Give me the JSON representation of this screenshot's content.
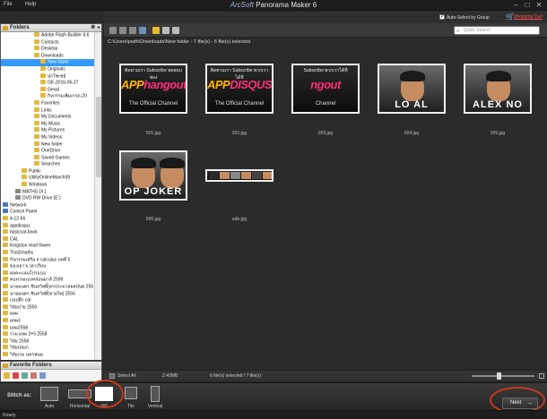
{
  "menu": {
    "file": "File",
    "help": "Help"
  },
  "app": {
    "brand": "ArcSoft",
    "title": " Panorama Maker 6"
  },
  "window_buttons": {
    "minimize": "–",
    "maximize": "□",
    "close": "✕"
  },
  "top_bar": {
    "auto_select_label": "Auto-Select by Group",
    "auto_select_checked": true,
    "shopping_cart": "Shopping Cart"
  },
  "search": {
    "placeholder": "Quick Search"
  },
  "path": {
    "text": "C:\\Users\\pwth\\Downloads\\New folder - 7 file(s)   - 6 file(s) selected"
  },
  "folders_panel": {
    "title": "Folders",
    "items": [
      {
        "label": "Adobe Flash Builder 4.6",
        "indent": 5,
        "icon": "folder"
      },
      {
        "label": "Contacts",
        "indent": 5,
        "icon": "folder"
      },
      {
        "label": "Desktop",
        "indent": 5,
        "icon": "folder"
      },
      {
        "label": "Downloads",
        "indent": 5,
        "icon": "folder"
      },
      {
        "label": "New folder",
        "indent": 6,
        "icon": "folder",
        "selected": true
      },
      {
        "label": "Originals",
        "indent": 6,
        "icon": "folder"
      },
      {
        "label": "ปกโซเชย์",
        "indent": 6,
        "icon": "folder"
      },
      {
        "label": "GE-2016-06-27",
        "indent": 6,
        "icon": "folder"
      },
      {
        "label": "Gmail",
        "indent": 6,
        "icon": "folder"
      },
      {
        "label": "กิจกรรมเพิ่มเกรด-20",
        "indent": 6,
        "icon": "folder"
      },
      {
        "label": "Favorites",
        "indent": 5,
        "icon": "folder"
      },
      {
        "label": "Links",
        "indent": 5,
        "icon": "folder"
      },
      {
        "label": "My Documents",
        "indent": 5,
        "icon": "folder"
      },
      {
        "label": "My Music",
        "indent": 5,
        "icon": "folder"
      },
      {
        "label": "My Pictures",
        "indent": 5,
        "icon": "folder"
      },
      {
        "label": "My Videos",
        "indent": 5,
        "icon": "folder"
      },
      {
        "label": "New folder",
        "indent": 5,
        "icon": "folder"
      },
      {
        "label": "OneDrive",
        "indent": 5,
        "icon": "folder"
      },
      {
        "label": "Saved Games",
        "indent": 5,
        "icon": "folder"
      },
      {
        "label": "Searches",
        "indent": 5,
        "icon": "folder"
      },
      {
        "label": "Public",
        "indent": 3,
        "icon": "folder"
      },
      {
        "label": "UtilityOnlineMarch09",
        "indent": 3,
        "icon": "folder"
      },
      {
        "label": "Windows",
        "indent": 3,
        "icon": "folder"
      },
      {
        "label": "MATHS (X:)",
        "indent": 2,
        "icon": "drive"
      },
      {
        "label": "DVD RW Drive (E:)",
        "indent": 2,
        "icon": "drive"
      },
      {
        "label": "Network",
        "indent": 0,
        "icon": "blue"
      },
      {
        "label": "Control Panel",
        "indent": 0,
        "icon": "blue"
      },
      {
        "label": "4-12-56",
        "indent": 0,
        "icon": "folder"
      },
      {
        "label": "appdisqus",
        "indent": 0,
        "icon": "folder"
      },
      {
        "label": "basiccal-book",
        "indent": 0,
        "icon": "folder"
      },
      {
        "label": "CAL",
        "indent": 0,
        "icon": "folder"
      },
      {
        "label": "Kingston read flower",
        "indent": 0,
        "icon": "folder"
      },
      {
        "label": "Thai2maths",
        "indent": 0,
        "icon": "folder"
      },
      {
        "label": "กิจกรรมเสริม e calculus บทที่ 5",
        "indent": 0,
        "icon": "folder"
      },
      {
        "label": "ของเยาวเวลาเรียน",
        "indent": 0,
        "icon": "folder"
      },
      {
        "label": "ผลคะแนนโปรแบบ",
        "indent": 0,
        "icon": "folder"
      },
      {
        "label": "ทบทวนแบงหล่อนมาล์ 2599",
        "indent": 0,
        "icon": "folder"
      },
      {
        "label": "นายมนตร ชินสวัสดิ์(ครประมวลผลบันต 256",
        "indent": 0,
        "icon": "folder"
      },
      {
        "label": "นายมนตร ชินสวัสดิ์(ทายไท) 2556",
        "indent": 0,
        "icon": "folder"
      },
      {
        "label": "แบบฝึก cal",
        "indent": 0,
        "icon": "folder"
      },
      {
        "label": "วิจัยปาย 2559",
        "indent": 0,
        "icon": "folder"
      },
      {
        "label": "ผลผ",
        "indent": 0,
        "icon": "folder"
      },
      {
        "label": "ผลผ3",
        "indent": 0,
        "icon": "folder"
      },
      {
        "label": "ผลผ2558",
        "indent": 0,
        "icon": "folder"
      },
      {
        "label": "รวม ผลผ 2+5 2558",
        "indent": 0,
        "icon": "folder"
      },
      {
        "label": "วิจัย 2558",
        "indent": 0,
        "icon": "folder"
      },
      {
        "label": "วิจัยปลอก",
        "indent": 0,
        "icon": "folder"
      },
      {
        "label": "วิจัยเรม นครพนม",
        "indent": 0,
        "icon": "folder"
      }
    ]
  },
  "favorites_panel": {
    "title": "Favorite Folders"
  },
  "thumbnails": [
    {
      "caption": "001.jpg",
      "kind": "banner",
      "top_text": "ติดตามเรา Subscribe ทดสอบช่อง",
      "logo_a": "APP",
      "logo_b": "hangout",
      "bottom_text": "The Official Channel"
    },
    {
      "caption": "002.jpg",
      "kind": "banner",
      "top_text": "ติดตามเรา Subscribe พวกเราได้ที่",
      "logo_a": "APP",
      "logo_b": "DISQUS",
      "bottom_text": "The Official Channel"
    },
    {
      "caption": "003.jpg",
      "kind": "banner",
      "top_text": "Subscribe พวกเราได้ที่",
      "logo_a": "",
      "logo_b": "ngout",
      "bottom_text": "Channel"
    },
    {
      "caption": "004.jpg",
      "kind": "portrait",
      "label": "LO  AL"
    },
    {
      "caption": "005.jpg",
      "kind": "portrait",
      "label": "ALEX NO"
    },
    {
      "caption": "006.jpg",
      "kind": "duo",
      "label": "OP  JOKER"
    },
    {
      "caption": "adb.jpg",
      "kind": "strip"
    }
  ],
  "status_strip": {
    "select_all": "Select All",
    "size": "2.40MB",
    "count": "6 file(s) selected / 7 file(s)"
  },
  "stitch": {
    "label": "Stitch as:",
    "modes": [
      "Auto",
      "Horizontal",
      "360",
      "Tile",
      "Vertical"
    ],
    "active": 2,
    "next": "Next"
  },
  "statusbar": {
    "text": "Ready."
  },
  "colors": {
    "highlight_circle": "#c8391a",
    "selected_row": "#3399ff",
    "cart_link": "#ff4d4d"
  }
}
